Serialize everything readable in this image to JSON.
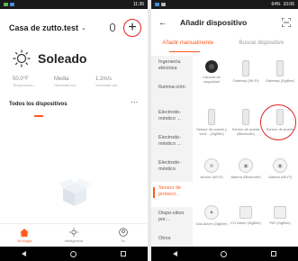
{
  "left": {
    "status": {
      "time": "11:36",
      "battery": ""
    },
    "home_title": "Casa de zutto.test",
    "weather": {
      "condition": "Soleado"
    },
    "stats": [
      {
        "value": "50.0°F",
        "label": "Temperatura..."
      },
      {
        "value": "Media",
        "label": "Humedad ext..."
      },
      {
        "value": "1.2m/s",
        "label": "Velocidad del..."
      }
    ],
    "all_devices_label": "Todos los dispositivos",
    "more_label": "···",
    "tabs": [
      {
        "label": "Mi hogar",
        "icon": "home-icon"
      },
      {
        "label": "Inteligencia",
        "icon": "sun-icon"
      },
      {
        "label": "Yo",
        "icon": "user-icon"
      }
    ]
  },
  "right": {
    "status": {
      "time": "10:06",
      "battery": "64%"
    },
    "title": "Añadir dispositivo",
    "tabs": [
      "Añadir manualmente",
      "Buscar dispositivo"
    ],
    "categories": [
      "Ingeniería eléctrica",
      "Ilumina-ción",
      "Electrodo-méstico ...",
      "Electrodo-méstico ...",
      "Electrodo-méstico",
      "Sensor de protecci...",
      "Dispo-sitivo por...",
      "Otros"
    ],
    "devices": [
      {
        "label": "Cámara de seguridad"
      },
      {
        "label": "Gateway (Wi-Fi)"
      },
      {
        "label": "Gateway (ZigBee)"
      },
      {
        "label": "Sensor de puerta y vent... (ZigBee)"
      },
      {
        "label": "Sensor de puerta (Bluetooth)"
      },
      {
        "label": "Sensor de puerta"
      },
      {
        "label": "sensor (Wi-Fi)"
      },
      {
        "label": "Alarma (Bluetooth)"
      },
      {
        "label": "Alarma (Wi-Fi)"
      },
      {
        "label": "Gas Alarm (ZigBee)"
      },
      {
        "label": "CO Alarm (ZigBee)"
      },
      {
        "label": "PIR (ZigBee)"
      }
    ]
  },
  "colors": {
    "accent": "#ff5a1f",
    "highlight": "#e02020"
  }
}
